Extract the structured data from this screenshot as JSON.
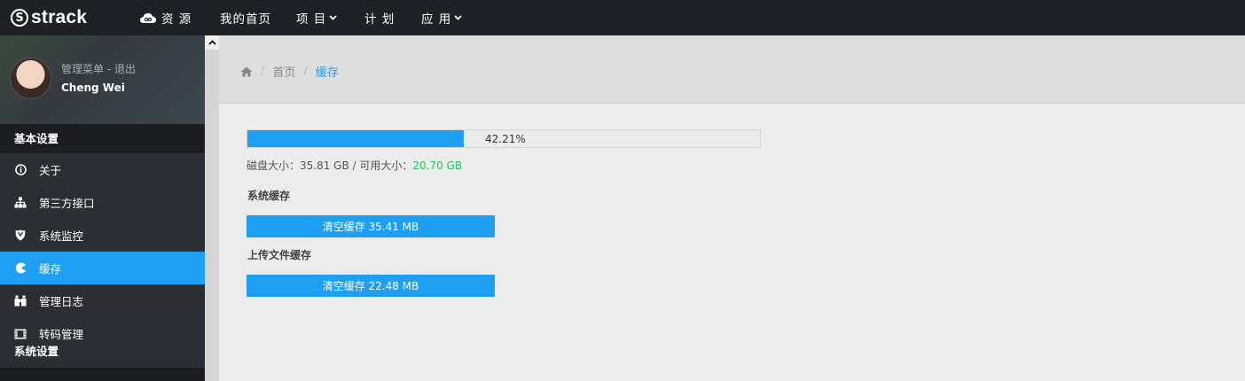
{
  "app": {
    "logo_mark": "S",
    "logo_text": "strack"
  },
  "topnav": {
    "items": [
      {
        "label": "资 源",
        "icon": "cloud-icon"
      },
      {
        "label": "我的首页"
      },
      {
        "label": "项 目",
        "dropdown": true
      },
      {
        "label": "计 划"
      },
      {
        "label": "应 用",
        "dropdown": true
      }
    ],
    "caret": "❯"
  },
  "sidebar": {
    "profile": {
      "menu_text": "管理菜单 - 退出",
      "name": "Cheng Wei"
    },
    "section": "基本设置",
    "items": [
      {
        "label": "关于",
        "icon": "info-icon"
      },
      {
        "label": "第三方接口",
        "icon": "sitemap-icon"
      },
      {
        "label": "系统监控",
        "icon": "shield-icon"
      },
      {
        "label": "缓存",
        "icon": "pie-icon",
        "active": true
      },
      {
        "label": "管理日志",
        "icon": "binoculars-icon"
      },
      {
        "label": "转码管理",
        "icon": "film-icon"
      }
    ],
    "next_section": "系统设置"
  },
  "breadcrumb": {
    "home_icon": "home-icon",
    "items": [
      "首页",
      "缓存"
    ],
    "separator": "/"
  },
  "disk": {
    "percent_text": "42.21%",
    "percent": 42.21,
    "size_label": "磁盘大小：",
    "size_value": "35.81 GB",
    "divider": " / ",
    "free_label": "可用大小：",
    "free_value": "20.70 GB"
  },
  "caches": [
    {
      "title": "系统缓存",
      "button": "清空缓存 35.41 MB"
    },
    {
      "title": "上传文件缓存",
      "button": "清空缓存 22.48 MB"
    }
  ],
  "colors": {
    "accent": "#1e9ff2",
    "topbar": "#1e2226",
    "sidebar": "#2b2e32",
    "free_value": "#22c15e"
  }
}
